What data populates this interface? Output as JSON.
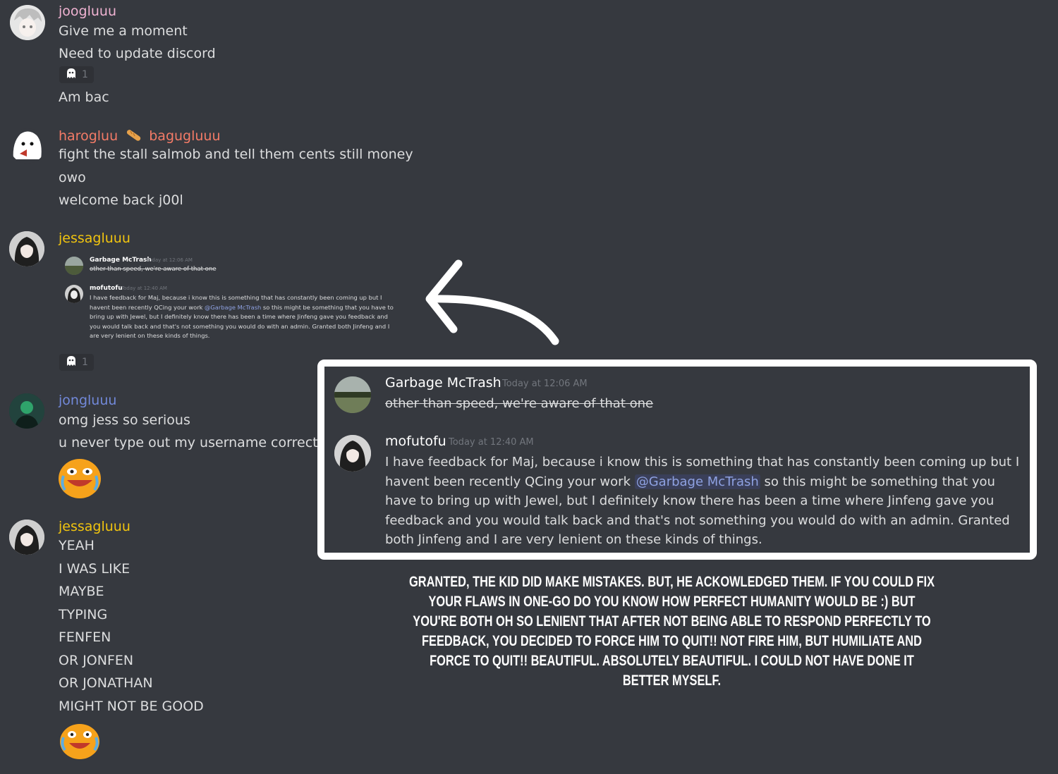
{
  "colors": {
    "background": "#36393f",
    "joogluuu": "#f0b3d2",
    "harogluu": "#f47b67",
    "bagugluuu": "#f47b67",
    "jessagluuu": "#f1c40f",
    "jongluuu": "#7289da",
    "mention": "#8ea1e1",
    "timestamp": "#72767d"
  },
  "messages": {
    "g1": {
      "username": "joogluuu",
      "lines": [
        "Give me a moment",
        "Need to update discord",
        "Am bac"
      ],
      "reaction": {
        "icon": "ghost-icon",
        "count": "1"
      }
    },
    "g2": {
      "username_a": "harogluu",
      "separator_icon": "baguette-icon",
      "username_b": "bagugluuu",
      "lines": [
        "fight the stall salmob and tell them cents still money",
        "owo",
        "welcome back j00l"
      ]
    },
    "g3": {
      "username": "jessagluuu",
      "reaction": {
        "icon": "ghost-icon",
        "count": "1"
      },
      "embed": {
        "m1": {
          "name": "Garbage McTrash",
          "time": "Today at 12:06 AM",
          "text": "other than speed, we're aware of that one"
        },
        "m2": {
          "name": "mofutofu",
          "time": "Today at 12:40 AM",
          "text_before": "I have feedback for Maj, because i know this is something that has constantly been coming up but I havent been recently QCing your work ",
          "mention": "@Garbage McTrash",
          "text_after": " so this might be something that you have to bring up with Jewel, but I definitely know there has been a time where Jinfeng gave you feedback and you would talk back and that's not something you would do with an admin. Granted both Jinfeng and I are very lenient on these kinds of things."
        }
      }
    },
    "g4": {
      "username": "jongluuu",
      "lines": [
        "omg jess so serious",
        "u never type out my username correctly"
      ],
      "emoji": "crying-blob-emoji"
    },
    "g5": {
      "username": "jessagluuu",
      "lines": [
        "YEAH",
        "I WAS LIKE",
        "MAYBE",
        "TYPING",
        "FENFEN",
        "OR JONFEN",
        "OR JONATHAN",
        "MIGHT NOT BE GOOD"
      ],
      "emoji": "crying-blob-emoji"
    }
  },
  "zoom": {
    "m1": {
      "name": "Garbage McTrash",
      "time": "Today at 12:06 AM",
      "text": "other than speed, we're aware of that one"
    },
    "m2": {
      "name": "mofutofu",
      "time": "Today at 12:40 AM",
      "text_before": "I have feedback for Maj, because i know this is something that has constantly been coming up but I havent been recently QCing your work ",
      "mention": "@Garbage McTrash",
      "text_after": " so this might be something that you have to bring up with Jewel, but I definitely know there has been a time where Jinfeng gave you feedback and you would talk back and that's not something you would do with an admin. Granted both Jinfeng and I are very lenient on these kinds of things."
    }
  },
  "caption": "GRANTED, THE KID DID MAKE MISTAKES. BUT, HE ACKOWLEDGED THEM. IF YOU COULD FIX YOUR FLAWS IN ONE-GO DO YOU KNOW HOW PERFECT HUMANITY WOULD BE :) BUT YOU'RE BOTH OH SO LENIENT THAT AFTER NOT BEING ABLE TO RESPOND PERFECTLY TO FEEDBACK, YOU DECIDED TO FORCE HIM TO QUIT!! NOT FIRE HIM, BUT HUMILIATE AND FORCE TO QUIT!! BEAUTIFUL. ABSOLUTELY BEAUTIFUL. I COULD NOT HAVE DONE IT BETTER MYSELF."
}
